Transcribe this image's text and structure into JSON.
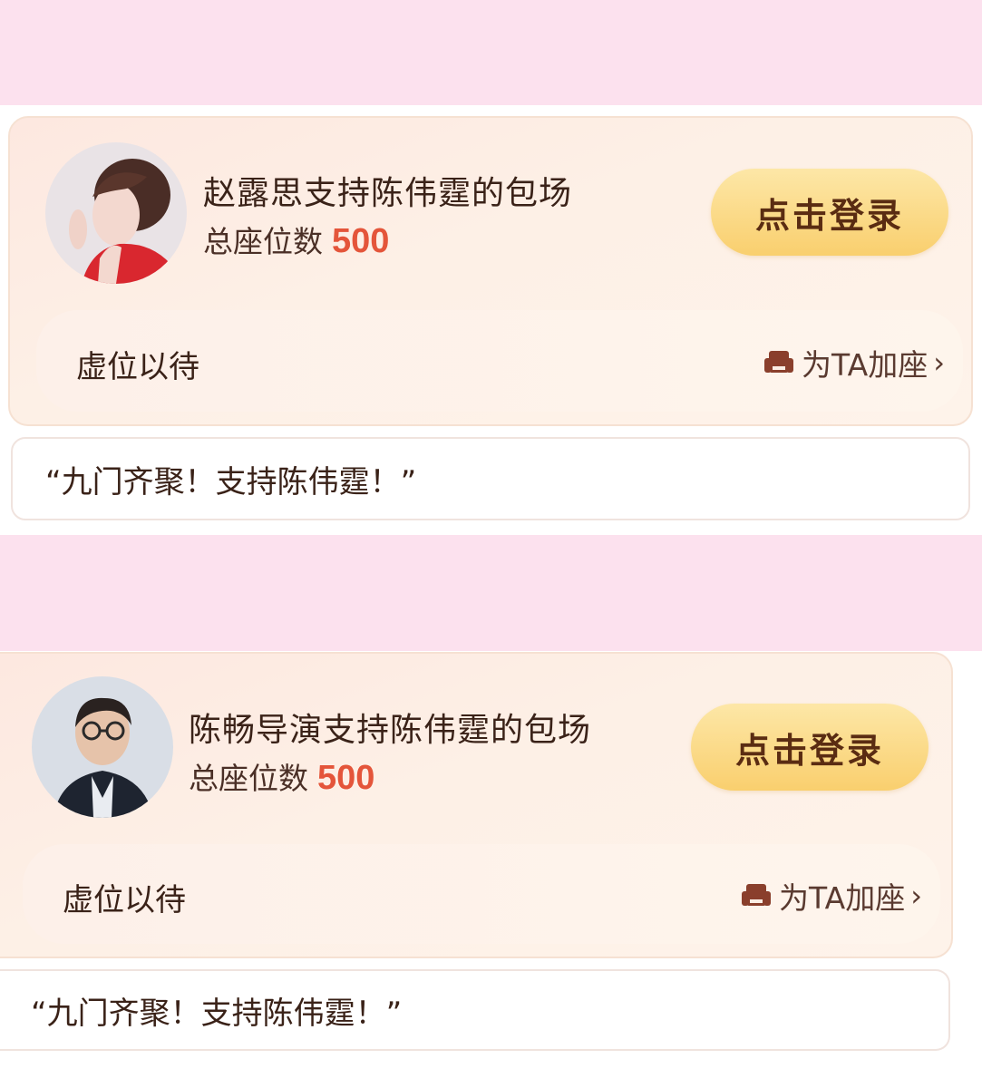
{
  "cards": [
    {
      "title": "赵露思支持陈伟霆的包场",
      "seat_label": "总座位数",
      "seat_count": "500",
      "login_label": "点击登录",
      "vacant_label": "虚位以待",
      "add_seat_label": "为TA加座",
      "message": "“九门齐聚！支持陈伟霆！”"
    },
    {
      "title": "陈畅导演支持陈伟霆的包场",
      "seat_label": "总座位数",
      "seat_count": "500",
      "login_label": "点击登录",
      "vacant_label": "虚位以待",
      "add_seat_label": "为TA加座",
      "message": "“九门齐聚！支持陈伟霆！”"
    }
  ],
  "icons": {
    "avatar_1": "woman-portrait-avatar",
    "avatar_2": "man-with-glasses-avatar",
    "sofa": "sofa-icon",
    "chevron": "chevron-right-icon"
  },
  "colors": {
    "band_pink": "#fce1ee",
    "seat_count": "#e4553a",
    "login_button": "#f9cf6e",
    "text_dark": "#3a2218"
  }
}
